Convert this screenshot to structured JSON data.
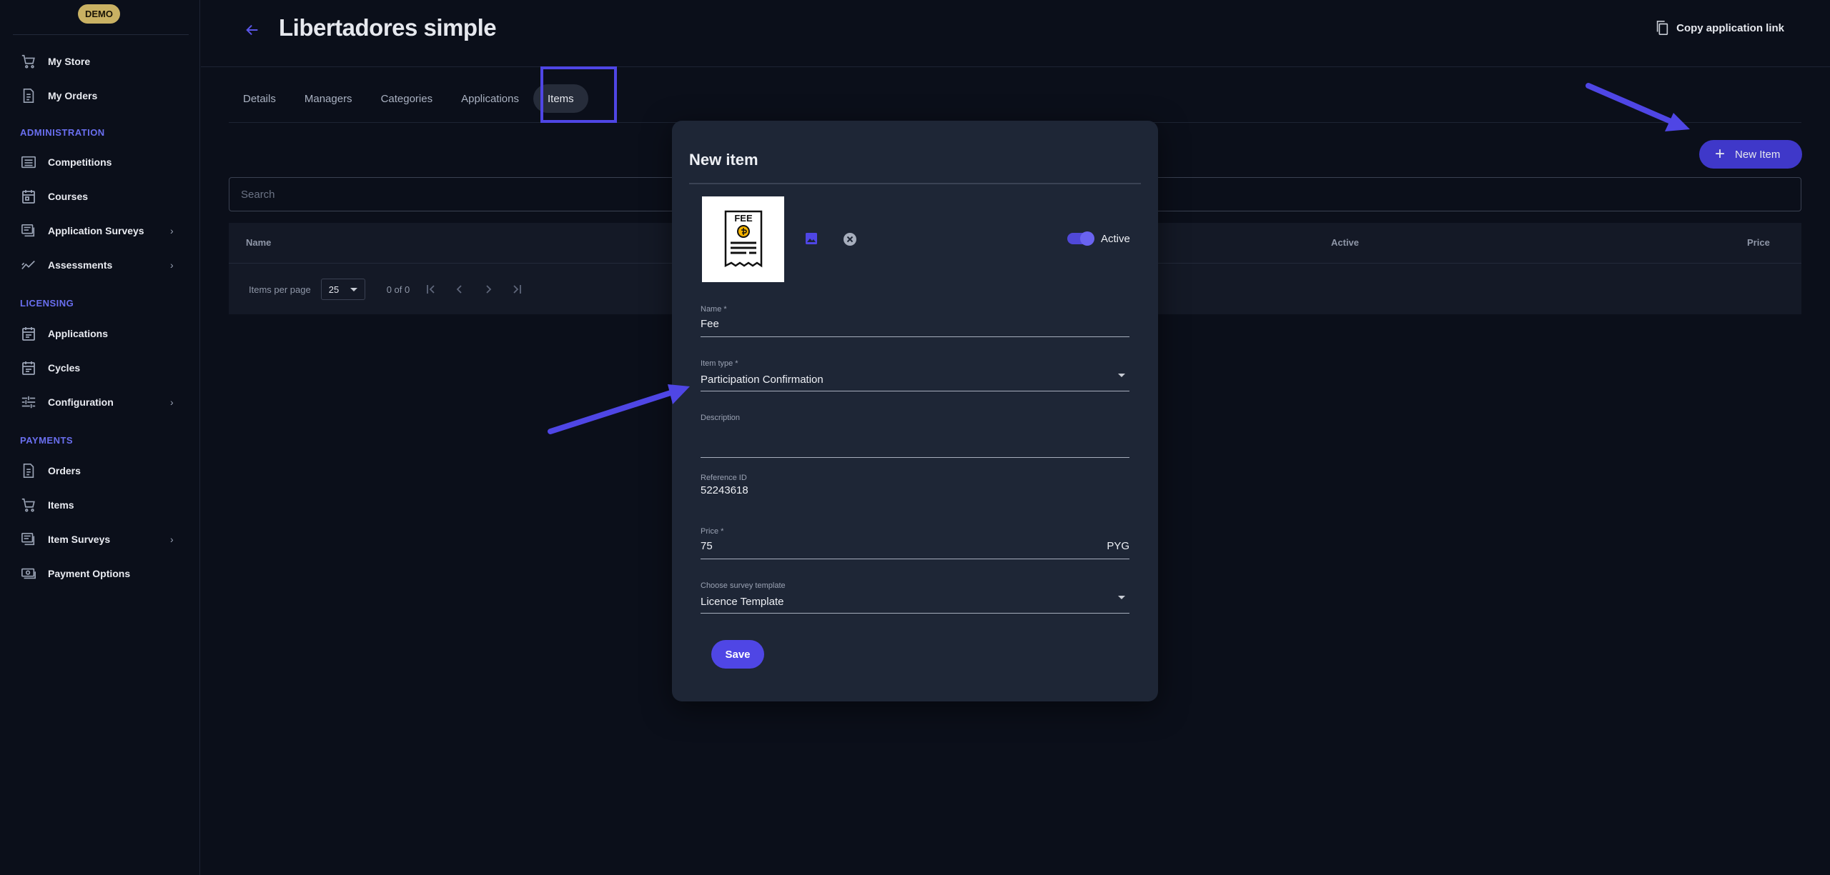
{
  "app": {
    "badge": "DEMO"
  },
  "sidebar": {
    "top_items": [
      {
        "label": "My Store",
        "icon": "cart-icon"
      },
      {
        "label": "My Orders",
        "icon": "document-icon"
      }
    ],
    "sections": [
      {
        "title": "ADMINISTRATION",
        "items": [
          {
            "label": "Competitions",
            "icon": "list-icon",
            "expandable": false
          },
          {
            "label": "Courses",
            "icon": "calendar-icon",
            "expandable": false
          },
          {
            "label": "Application Surveys",
            "icon": "survey-icon",
            "expandable": true
          },
          {
            "label": "Assessments",
            "icon": "trend-icon",
            "expandable": true
          }
        ]
      },
      {
        "title": "LICENSING",
        "items": [
          {
            "label": "Applications",
            "icon": "calendar-icon",
            "expandable": false
          },
          {
            "label": "Cycles",
            "icon": "calendar-icon",
            "expandable": false
          },
          {
            "label": "Configuration",
            "icon": "sliders-icon",
            "expandable": true
          }
        ]
      },
      {
        "title": "PAYMENTS",
        "items": [
          {
            "label": "Orders",
            "icon": "document-icon",
            "expandable": false
          },
          {
            "label": "Items",
            "icon": "cart-icon",
            "expandable": false
          },
          {
            "label": "Item Surveys",
            "icon": "survey-icon",
            "expandable": true
          },
          {
            "label": "Payment Options",
            "icon": "money-icon",
            "expandable": false
          }
        ]
      }
    ]
  },
  "header": {
    "title": "Libertadores simple",
    "copy_link": "Copy application link"
  },
  "tabs": [
    "Details",
    "Managers",
    "Categories",
    "Applications",
    "Items"
  ],
  "active_tab": "Items",
  "toolbar": {
    "new_item": "New Item"
  },
  "search": {
    "placeholder": "Search",
    "value": ""
  },
  "table": {
    "columns": [
      "Name",
      "Active",
      "Price"
    ],
    "items_per_page_label": "Items per page",
    "items_per_page": "25",
    "range": "0 of 0"
  },
  "modal": {
    "title": "New item",
    "thumbnail_text": "FEE",
    "active_label": "Active",
    "active": true,
    "fields": {
      "name": {
        "label": "Name *",
        "value": "Fee"
      },
      "item_type": {
        "label": "Item type *",
        "value": "Participation Confirmation"
      },
      "description": {
        "label": "Description",
        "value": ""
      },
      "reference_id": {
        "label": "Reference ID",
        "value": "52243618"
      },
      "price": {
        "label": "Price *",
        "value": "75",
        "currency": "PYG"
      },
      "survey_template": {
        "label": "Choose survey template",
        "value": "Licence Template"
      }
    },
    "save_label": "Save"
  },
  "colors": {
    "accent": "#4f46e5",
    "annotation": "#4f46e5",
    "badge": "#c9b163"
  }
}
